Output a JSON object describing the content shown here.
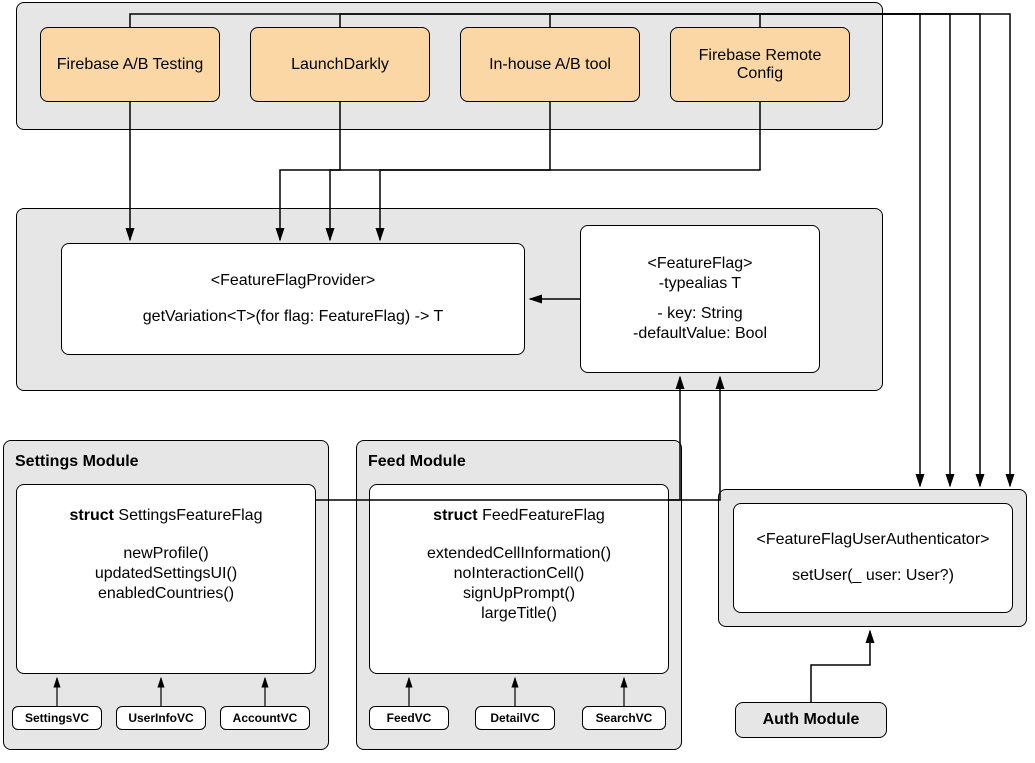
{
  "providers": {
    "items": [
      "Firebase A/B Testing",
      "LaunchDarkly",
      "In-house A/B tool",
      "Firebase Remote Config"
    ]
  },
  "protocols": {
    "featureFlagProvider": {
      "title": "<FeatureFlagProvider>",
      "method": "getVariation<T>(for flag: FeatureFlag) -> T"
    },
    "featureFlag": {
      "title": "<FeatureFlag>",
      "line2": "-typealias T",
      "line3": "- key: String",
      "line4": "-defaultValue: Bool"
    },
    "authenticator": {
      "title": "<FeatureFlagUserAuthenticator>",
      "method": "setUser(_ user: User?)"
    }
  },
  "modules": {
    "settings": {
      "label": "Settings Module",
      "structPrefix": "struct",
      "structName": " SettingsFeatureFlag",
      "methods": [
        "newProfile()",
        "updatedSettingsUI()",
        "enabledCountries()"
      ],
      "vcs": [
        "SettingsVC",
        "UserInfoVC",
        "AccountVC"
      ]
    },
    "feed": {
      "label": "Feed Module",
      "structPrefix": "struct",
      "structName": " FeedFeatureFlag",
      "methods": [
        "extendedCellInformation()",
        "noInteractionCell()",
        "signUpPrompt()",
        "largeTitle()"
      ],
      "vcs": [
        "FeedVC",
        "DetailVC",
        "SearchVC"
      ]
    },
    "auth": {
      "label": "Auth Module"
    }
  }
}
